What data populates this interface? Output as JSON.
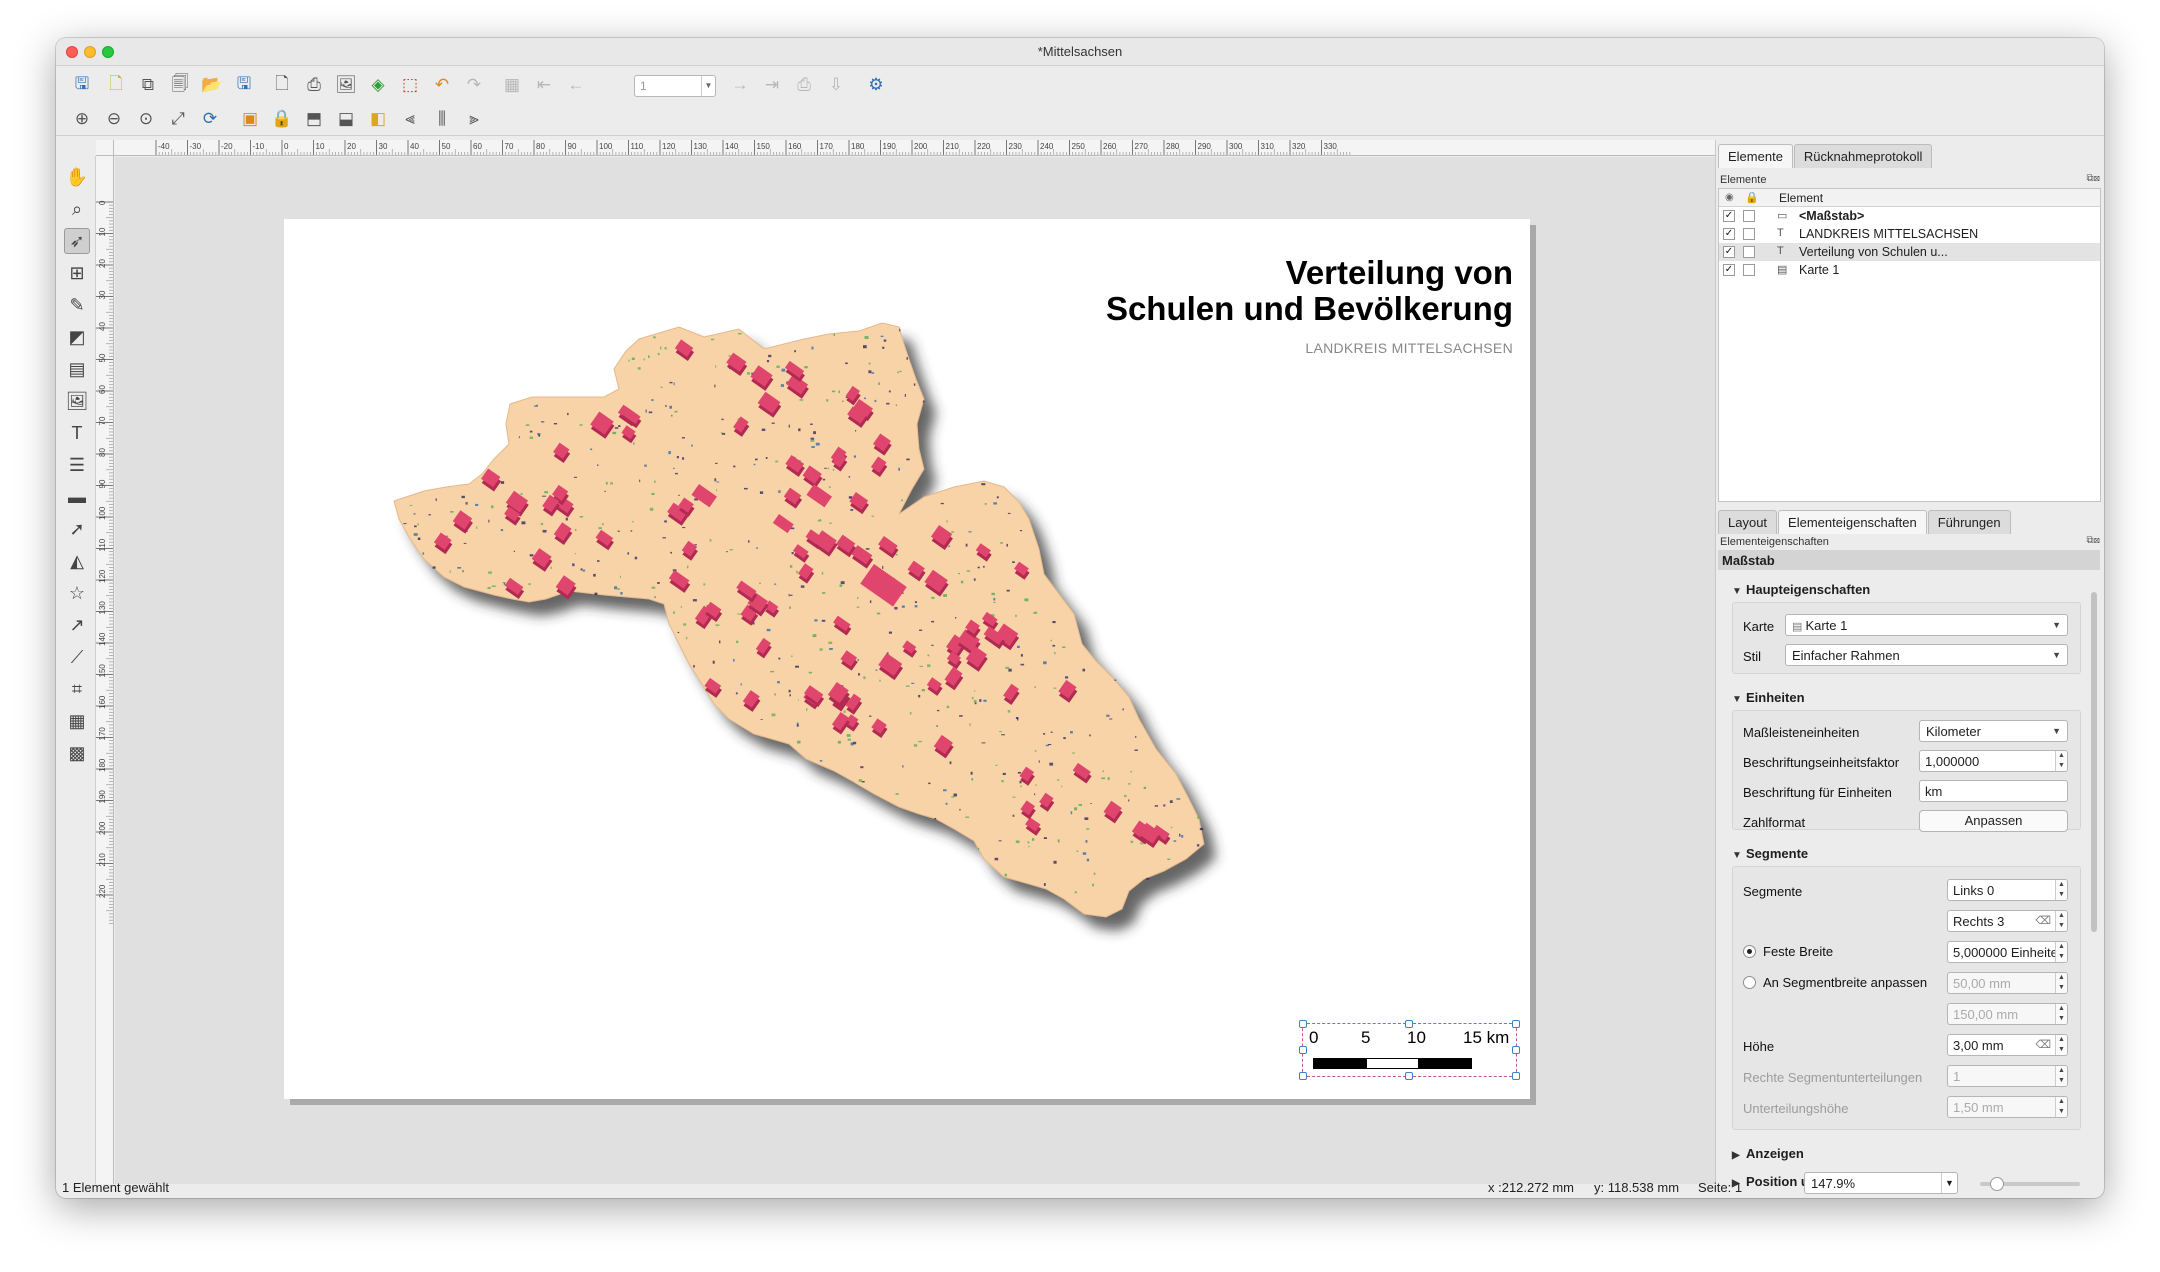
{
  "window": {
    "title": "*Mittelsachsen"
  },
  "toolbar": {
    "page_number": "1"
  },
  "rulers": {
    "h_ticks": [
      "-40",
      "-30",
      "-20",
      "-10",
      "0",
      "10",
      "20",
      "30",
      "40",
      "50",
      "60",
      "70",
      "80",
      "90",
      "100",
      "110",
      "120",
      "130",
      "140",
      "150",
      "160",
      "170",
      "180",
      "190",
      "200",
      "210",
      "220",
      "230",
      "240",
      "250",
      "260",
      "270",
      "280",
      "290",
      "300",
      "310",
      "320",
      "330"
    ],
    "v_ticks": [
      "0",
      "10",
      "20",
      "30",
      "40",
      "50",
      "60",
      "70",
      "80",
      "90",
      "100",
      "110",
      "120",
      "130",
      "140",
      "150",
      "160",
      "170",
      "180",
      "190",
      "200",
      "210",
      "220"
    ]
  },
  "layout_page": {
    "title_line1": "Verteilung von",
    "title_line2": "Schulen und Bevölkerung",
    "subtitle": "LANDKREIS MITTELSACHSEN",
    "scalebar_labels": [
      "0",
      "5",
      "10",
      "15 km"
    ]
  },
  "items_panel": {
    "tabs": [
      "Elemente",
      "Rücknahmeprotokoll"
    ],
    "panel_title": "Elemente",
    "column_header": "Element",
    "items": [
      {
        "name": "<Maßstab>",
        "icon": "scalebar-icon",
        "checked": true,
        "locked": false,
        "bold": true
      },
      {
        "name": "LANDKREIS MITTELSACHSEN",
        "icon": "text-label-icon",
        "checked": true,
        "locked": false
      },
      {
        "name": "Verteilung von Schulen u...",
        "icon": "text-label-icon",
        "checked": true,
        "locked": false,
        "selected": true
      },
      {
        "name": "Karte 1",
        "icon": "map-item-icon",
        "checked": true,
        "locked": false
      }
    ]
  },
  "properties_panel": {
    "tabs": [
      "Layout",
      "Elementeigenschaften",
      "Führungen"
    ],
    "panel_title": "Elementeigenschaften",
    "item_type": "Maßstab",
    "main": {
      "heading": "Haupteigenschaften",
      "map_label": "Karte",
      "map_value": "Karte 1",
      "style_label": "Stil",
      "style_value": "Einfacher Rahmen"
    },
    "units": {
      "heading": "Einheiten",
      "scalebar_units_label": "Maßleisteneinheiten",
      "scalebar_units_value": "Kilometer",
      "label_unit_multiplier_label": "Beschriftungseinheitsfaktor",
      "label_unit_multiplier_value": "1,000000",
      "label_for_units_label": "Beschriftung für Einheiten",
      "label_for_units_value": "km",
      "number_format_label": "Zahlformat",
      "number_format_button": "Anpassen"
    },
    "segments": {
      "heading": "Segmente",
      "segments_label": "Segmente",
      "left_value": "Links 0",
      "right_value": "Rechts 3",
      "fixed_width_label": "Feste Breite",
      "fixed_width_value": "5,000000 Einheiten",
      "fit_label": "An Segmentbreite anpassen",
      "fit_min": "50,00 mm",
      "fit_max": "150,00 mm",
      "height_label": "Höhe",
      "height_value": "3,00 mm",
      "right_subdivisions_label": "Rechte Segmentunterteilungen",
      "right_subdivisions_value": "1",
      "subdivision_height_label": "Unterteilungshöhe",
      "subdivision_height_value": "1,50 mm"
    },
    "collapsed_sections": [
      "Anzeigen",
      "Position und Größe"
    ]
  },
  "statusbar": {
    "selection": "1 Element gewählt",
    "x": "x :212.272 mm",
    "y": "y: 118.538 mm",
    "page": "Seite: 1",
    "zoom": "147.9%"
  },
  "colors": {
    "district_fill": "#f8d3a8",
    "population_markers": "#e0456e",
    "shadow": "#333333",
    "selection_frame": "#c05a8a"
  }
}
